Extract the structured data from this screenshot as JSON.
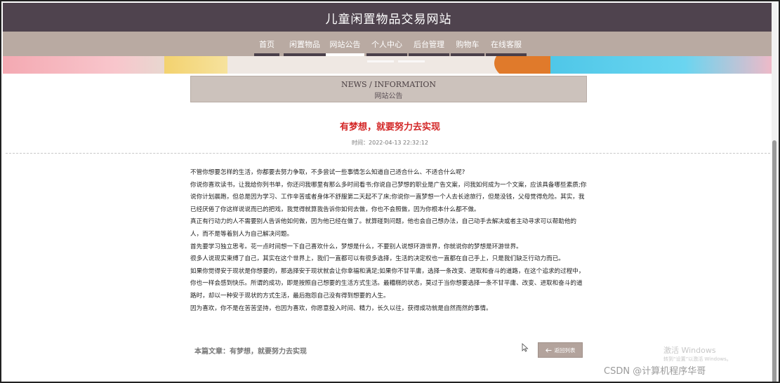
{
  "site": {
    "title": "儿童闲置物品交易网站"
  },
  "nav": {
    "items": [
      {
        "label": "首页"
      },
      {
        "label": "闲置物品"
      },
      {
        "label": "网站公告"
      },
      {
        "label": "个人中心"
      },
      {
        "label": "后台管理"
      },
      {
        "label": "购物车"
      },
      {
        "label": "在线客服"
      }
    ],
    "active_index": 2
  },
  "section": {
    "title_en": "NEWS / INFORMATION",
    "title_cn": "网站公告"
  },
  "article": {
    "title": "有梦想，就要努力去实现",
    "time": "时间：2022-04-13 22:32:12",
    "paragraphs": [
      "不管你想要怎样的生活，你都要去努力争取，不多尝试一些事情怎么知道自己适合什么、不适合什么呢?",
      "你说你喜欢读书，让我给你列书单，你还问我哪里有那么多时间看书;你说自己梦想的职业是广告文案，问我如何成为一个文案，应该具备哪些素质;你说你计划晨跑，但总是因为学习、工作辛苦或者身体不舒服第二天起不了床;你说你一直梦想一个人去长途旅行，但是没钱，父母觉得危险。其实，我已经厌倦了你这样说说而已的把戏，我觉得就算我告诉你如何去做，你也不会照做，因为你根本什么都不做。",
      "真正有行动力的人不需要别人告诉他如何做，因为他已经在做了。就算碰到问题，他也会自己想办法，自己动手去解决或者主动寻求可以帮助他的人，而不是等着别人为自己解决问题。",
      "首先要学习独立思考。花一点时间想一下自己喜欢什么，梦想是什么，不要别人说想环游世界，你就说你的梦想是环游世界。",
      "很多人说现实束缚了自己，其实在这个世界上，我们一直都可以有很多选择，生活的决定权也一直都在自己手上，只是我们缺乏行动力而已。",
      "如果你觉得安于现状是你想要的，那选择安于现状就会让你幸福和满足;如果你不甘平庸，选择一条改变、进取和奋斗的道路，在这个追求的过程中，你也一样会感到快乐。所谓的成功，即是按照自己想要的生活方式生活。最糟糕的状态，莫过于当你想要选择一条不甘平庸、改变、进取和奋斗的道路时，却以一种安于现状的方式生活，最后抱怨自己没有得到想要的人生。",
      "因为喜欢，你不是在苦苦坚持，也因为喜欢，你愿意投入时间、精力，长久以往，获得成功就是自然而然的事情。"
    ],
    "footer_label": "本篇文章：有梦想，就要努力去实现",
    "back_button": "返回列表"
  },
  "watermarks": {
    "windows_line1": "激活 Windows",
    "windows_line2": "转到“设置”以激活 Windows。",
    "csdn": "CSDN @计算机程序华哥"
  },
  "colors": {
    "topbar": "#4f434e",
    "navbar": "#b9aaa2",
    "title_red": "#d32727",
    "news_box": "#ccc2bc",
    "back_button": "#b3a39c"
  }
}
